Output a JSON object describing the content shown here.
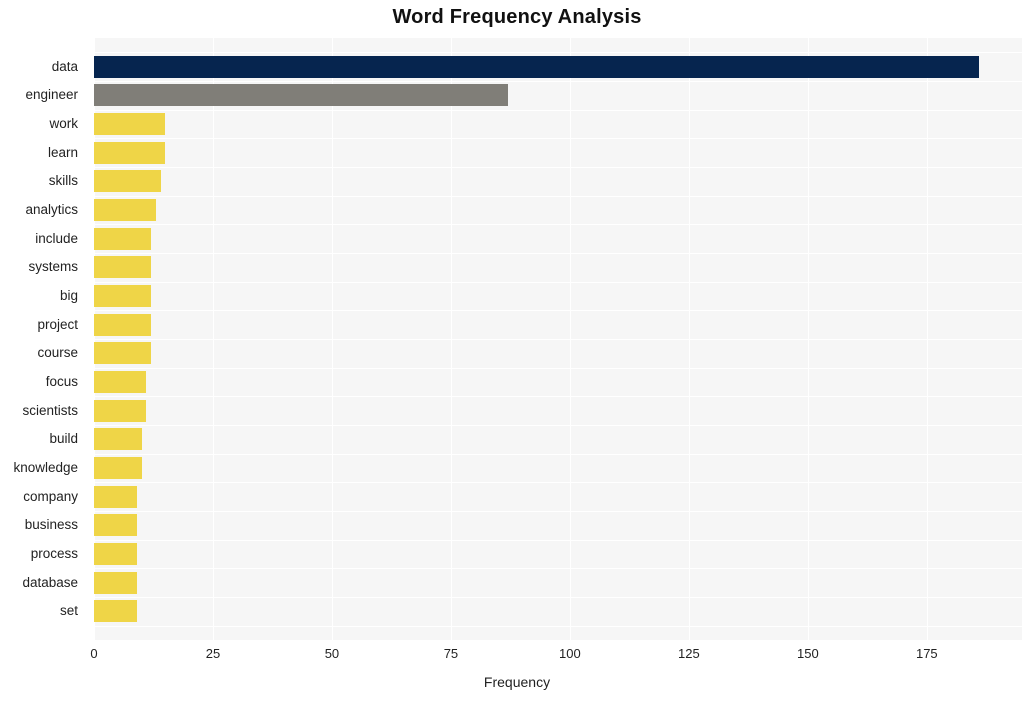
{
  "chart_data": {
    "type": "bar",
    "orientation": "horizontal",
    "title": "Word Frequency Analysis",
    "xlabel": "Frequency",
    "ylabel": "",
    "xlim": [
      0,
      195
    ],
    "xticks": [
      0,
      25,
      50,
      75,
      100,
      125,
      150,
      175
    ],
    "xtick_labels": [
      "0",
      "25",
      "50",
      "75",
      "100",
      "125",
      "150",
      "175"
    ],
    "grid": true,
    "legend": null,
    "categories": [
      "data",
      "engineer",
      "work",
      "learn",
      "skills",
      "analytics",
      "include",
      "systems",
      "big",
      "project",
      "course",
      "focus",
      "scientists",
      "build",
      "knowledge",
      "company",
      "business",
      "process",
      "database",
      "set"
    ],
    "values": [
      186,
      87,
      15,
      15,
      14,
      13,
      12,
      12,
      12,
      12,
      12,
      11,
      11,
      10,
      10,
      9,
      9,
      9,
      9,
      9
    ],
    "bar_colors": [
      "#06254f",
      "#807e78",
      "#efd547",
      "#efd547",
      "#efd547",
      "#efd547",
      "#efd547",
      "#efd547",
      "#efd547",
      "#efd547",
      "#efd547",
      "#efd547",
      "#efd547",
      "#efd547",
      "#efd547",
      "#efd547",
      "#efd547",
      "#efd547",
      "#efd547",
      "#efd547"
    ],
    "plot_background": "#f6f6f6",
    "gridline_color": "#ffffff",
    "figure_background": "#ffffff"
  }
}
